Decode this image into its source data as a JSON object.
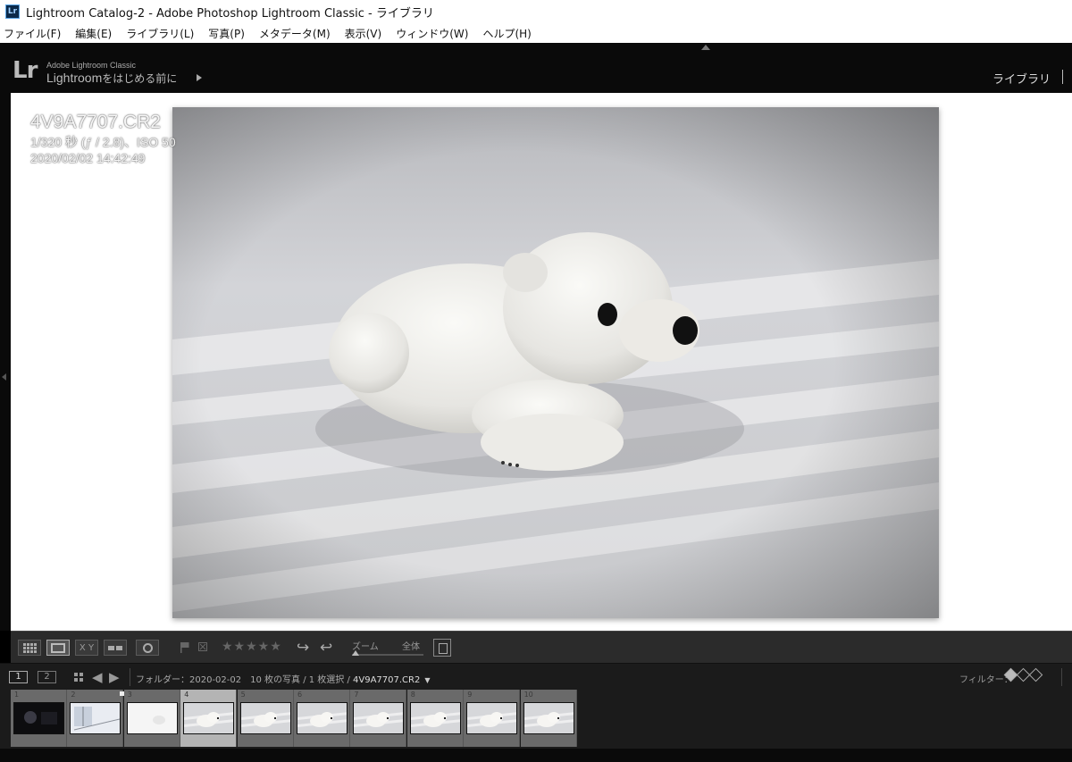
{
  "window": {
    "app_icon": "Lr",
    "title": "Lightroom Catalog-2 - Adobe Photoshop Lightroom Classic - ライブラリ"
  },
  "menu": [
    {
      "label": "ファイル(F)"
    },
    {
      "label": "編集(E)"
    },
    {
      "label": "ライブラリ(L)"
    },
    {
      "label": "写真(P)"
    },
    {
      "label": "メタデータ(M)"
    },
    {
      "label": "表示(V)"
    },
    {
      "label": "ウィンドウ(W)"
    },
    {
      "label": "ヘルプ(H)"
    }
  ],
  "identity": {
    "logo": "Lr",
    "brand": "Adobe Lightroom Classic",
    "tagline_prefix": "Lightroom",
    "tagline_suffix": "をはじめる前に",
    "module": "ライブラリ"
  },
  "photo_info": {
    "filename": "4V9A7707.CR2",
    "exposure": "1/320 秒 (ƒ / 2.8)、ISO 50",
    "datetime": "2020/02/02 14:42:49"
  },
  "toolbar": {
    "compare_label": "X Y",
    "stars": "★★★★★",
    "zoom_label": "ズーム",
    "zoom_value": "全体"
  },
  "navbar": {
    "screen1": "1",
    "screen2": "2",
    "path_prefix": "フォルダー：2020-02-02　10 枚の写真 / 1 枚選択 / ",
    "path_filename": "4V9A7707.CR2",
    "filter_label": "フィルター："
  },
  "filmstrip": {
    "selected_index": 4,
    "cells": [
      {
        "num": "1",
        "tone": "dark"
      },
      {
        "num": "2",
        "tone": "window"
      },
      {
        "num": "3",
        "tone": "white"
      },
      {
        "num": "4",
        "tone": "bear"
      },
      {
        "num": "5",
        "tone": "bear"
      },
      {
        "num": "6",
        "tone": "bear"
      },
      {
        "num": "7",
        "tone": "bear"
      },
      {
        "num": "8",
        "tone": "bear"
      },
      {
        "num": "9",
        "tone": "bear"
      },
      {
        "num": "10",
        "tone": "bear"
      }
    ]
  },
  "colors": {
    "panel_dark": "#0a0a0a",
    "toolbar": "#2b2b2b",
    "filmstrip": "#1b1b1b",
    "selected_cell": "#b4b4b4"
  }
}
